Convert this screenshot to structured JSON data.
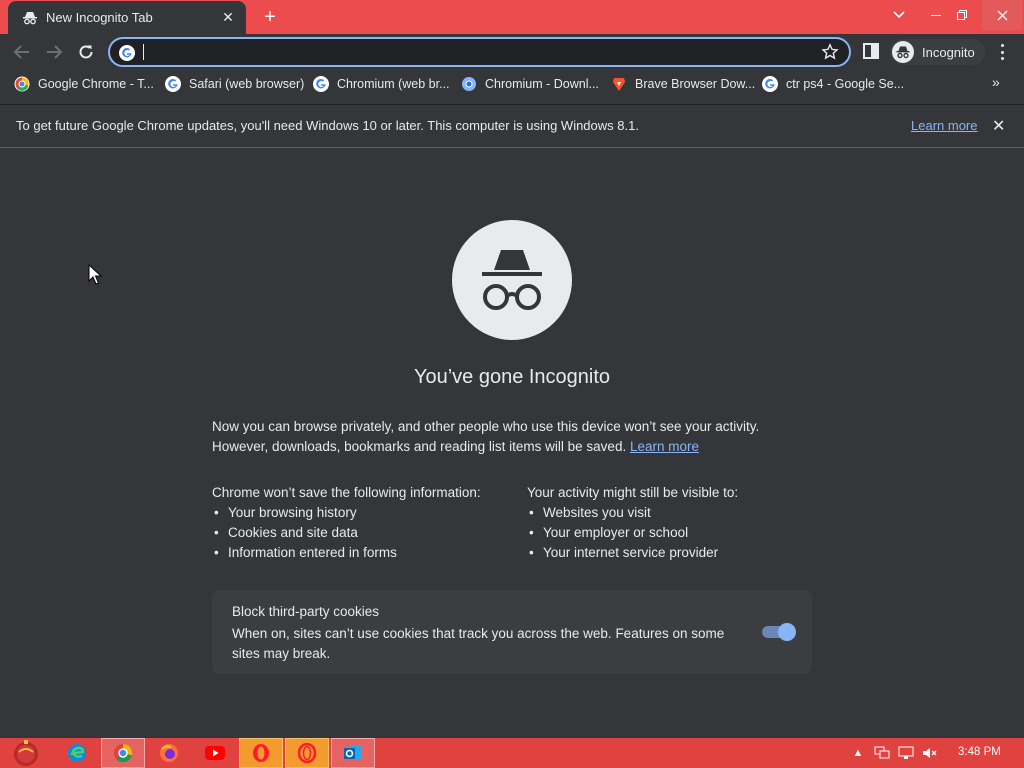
{
  "colors": {
    "titlebar": "#ed4c4e",
    "background": "#35363a",
    "link": "#8ab4f8",
    "taskbar": "#e0423f"
  },
  "tab": {
    "title": "New Incognito Tab",
    "icon": "incognito-icon",
    "close_symbol": "✕"
  },
  "window_controls": {
    "tab_search": "⌄",
    "minimize": "—",
    "restore": "❐",
    "close": "✕"
  },
  "toolbar": {
    "omnibox_value": "",
    "incognito_label": "Incognito"
  },
  "bookmarks": [
    {
      "label": "Google Chrome - T...",
      "icon": "google-icon"
    },
    {
      "label": "Safari (web browser)",
      "icon": "google-icon"
    },
    {
      "label": "Chromium (web br...",
      "icon": "google-icon"
    },
    {
      "label": "Chromium - Downl...",
      "icon": "chromium-icon"
    },
    {
      "label": "Brave Browser Dow...",
      "icon": "brave-icon"
    },
    {
      "label": "ctr ps4 - Google Se...",
      "icon": "google-icon"
    }
  ],
  "infobar": {
    "message": "To get future Google Chrome updates, you'll need Windows 10 or later. This computer is using Windows 8.1.",
    "learn_more": "Learn more"
  },
  "page": {
    "heading": "You’ve gone Incognito",
    "intro_line1": "Now you can browse privately, and other people who use this device won’t see your activity.",
    "intro_line2": "However, downloads, bookmarks and reading list items will be saved.",
    "intro_link": "Learn more",
    "left_title": "Chrome won’t save the following information:",
    "left_items": [
      "Your browsing history",
      "Cookies and site data",
      "Information entered in forms"
    ],
    "right_title": "Your activity might still be visible to:",
    "right_items": [
      "Websites you visit",
      "Your employer or school",
      "Your internet service provider"
    ],
    "cookie_title": "Block third-party cookies",
    "cookie_desc": "When on, sites can’t use cookies that track you across the web. Features on some sites may break.",
    "cookie_toggle_on": true
  },
  "taskbar": {
    "items": [
      "start-orb",
      "edge-icon",
      "chrome-icon",
      "firefox-icon",
      "youtube-icon",
      "opera-icon",
      "opera-gx-icon",
      "outlook-icon"
    ],
    "clock": "3:48 PM"
  }
}
